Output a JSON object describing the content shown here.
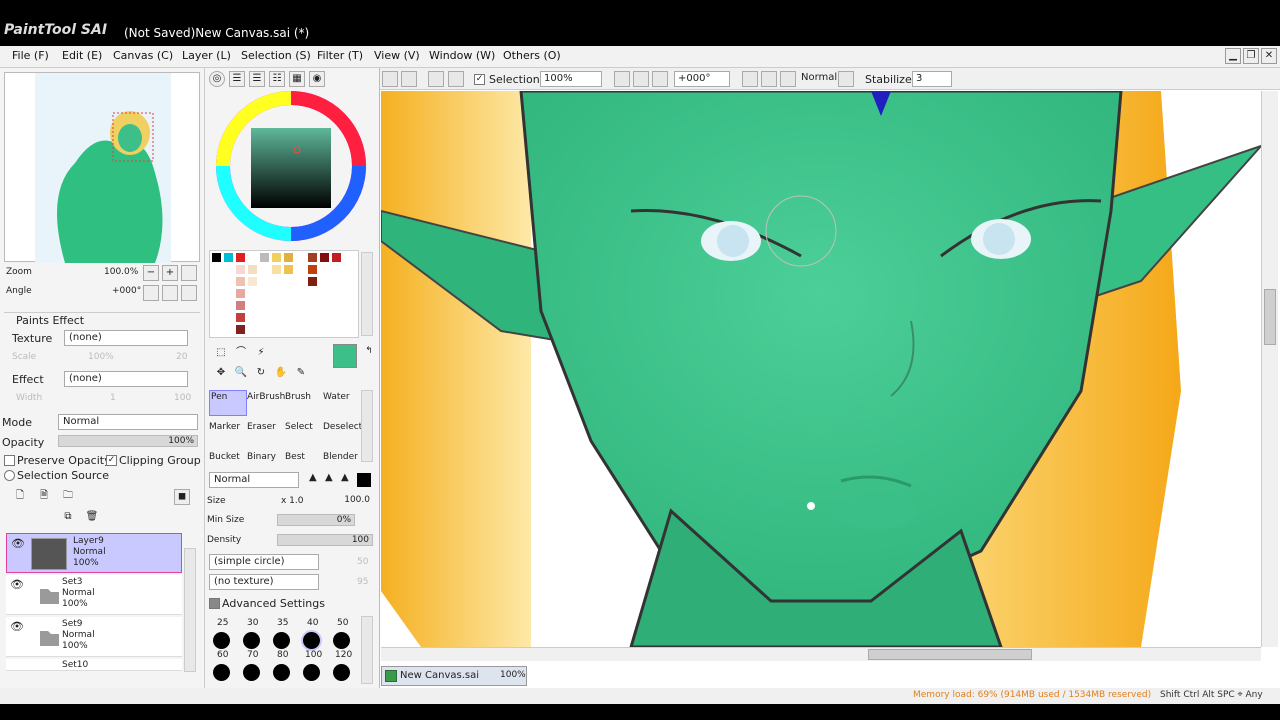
{
  "window": {
    "app_logo": "PaintTool SAI",
    "title": "(Not Saved)New Canvas.sai (*)"
  },
  "menu": [
    "File (F)",
    "Edit (E)",
    "Canvas (C)",
    "Layer (L)",
    "Selection (S)",
    "Filter (T)",
    "View (V)",
    "Window (W)",
    "Others (O)"
  ],
  "toolbar": {
    "selection_label": "Selection",
    "zoom": "100%",
    "angle": "+000°",
    "mode": "Normal",
    "stabilizer_label": "Stabilizer",
    "stabilizer_value": "3"
  },
  "navigator": {
    "zoom_label": "Zoom",
    "zoom_value": "100.0%",
    "angle_label": "Angle",
    "angle_value": "+000°"
  },
  "paints_effect": {
    "header": "Paints Effect",
    "texture_label": "Texture",
    "texture_value": "(none)",
    "scale_label": "Scale",
    "scale_value": "100%",
    "scale_num": "20",
    "effect_label": "Effect",
    "effect_value": "(none)",
    "width_label": "Width",
    "width_value": "1",
    "width_num": "100"
  },
  "layer_props": {
    "mode_label": "Mode",
    "mode_value": "Normal",
    "opacity_label": "Opacity",
    "opacity_value": "100%",
    "preserve_opacity": "Preserve Opacity",
    "clipping_group": "Clipping Group",
    "selection_source": "Selection Source"
  },
  "layers": [
    {
      "name": "Layer9",
      "mode": "Normal",
      "opacity": "100%"
    },
    {
      "name": "Set3",
      "mode": "Normal",
      "opacity": "100%"
    },
    {
      "name": "Set9",
      "mode": "Normal",
      "opacity": "100%"
    },
    {
      "name": "Set10",
      "mode": "",
      "opacity": ""
    }
  ],
  "tools": {
    "row1": [
      "Pen",
      "AirBrush",
      "Brush",
      "Water"
    ],
    "row2": [
      "Marker",
      "Eraser",
      "Select",
      "Deselect"
    ],
    "row3": [
      "Bucket",
      "Binary",
      "Best",
      "Blender"
    ]
  },
  "brush": {
    "mode": "Normal",
    "size_label": "Size",
    "size_mult": "x 1.0",
    "size_value": "100.0",
    "min_size_label": "Min Size",
    "min_size_value": "0%",
    "density_label": "Density",
    "density_value": "100",
    "shape": "(simple circle)",
    "shape_num": "50",
    "texture": "(no texture)",
    "texture_num": "95",
    "advanced": "Advanced Settings",
    "size_presets_row1": [
      "25",
      "30",
      "35",
      "40",
      "50"
    ],
    "size_presets_row2": [
      "60",
      "70",
      "80",
      "100",
      "120"
    ]
  },
  "color": {
    "current": "#3dbf8a",
    "wheel_hue": "#ff2040"
  },
  "document_tab": {
    "name": "New Canvas.sai",
    "zoom": "100%"
  },
  "status": {
    "memory": "Memory load: 69% (914MB used / 1534MB reserved)",
    "keys": "Shift Ctrl Alt SPC ⌖ Any"
  }
}
